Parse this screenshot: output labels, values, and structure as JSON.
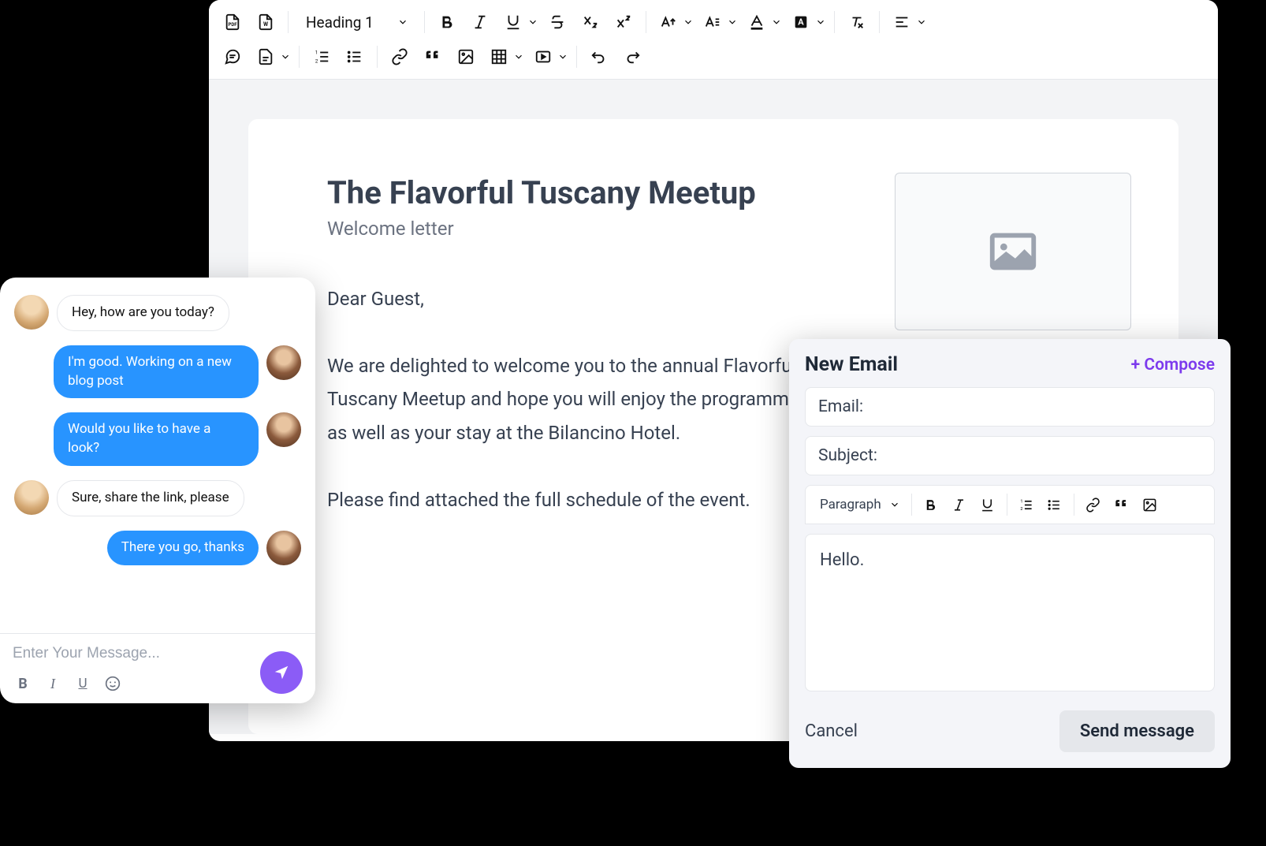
{
  "editor": {
    "toolbar": {
      "heading_dropdown": "Heading 1"
    },
    "document": {
      "title": "The Flavorful Tuscany Meetup",
      "subtitle": "Welcome letter",
      "greeting": "Dear Guest,",
      "paragraph1": "We are delighted to welcome you to the annual Flavorful Tuscany Meetup and hope you will enjoy the programme as well as your stay at the Bilancino Hotel.",
      "paragraph2": "Please find attached the full schedule of the event."
    }
  },
  "chat": {
    "messages": [
      {
        "side": "left",
        "avatar": "blonde",
        "text": "Hey, how are you today?"
      },
      {
        "side": "right",
        "avatar": "glasses",
        "text": "I'm good. Working on a new blog post"
      },
      {
        "side": "right",
        "avatar": "glasses",
        "text": "Would you like to have a look?"
      },
      {
        "side": "left",
        "avatar": "blonde",
        "text": "Sure, share the link, please"
      },
      {
        "side": "right",
        "avatar": "glasses",
        "text": "There you go, thanks"
      }
    ],
    "input_placeholder": "Enter Your Message..."
  },
  "email": {
    "title": "New Email",
    "compose_link": "+ Compose",
    "email_label": "Email:",
    "subject_label": "Subject:",
    "toolbar_dropdown": "Paragraph",
    "body": "Hello.",
    "cancel": "Cancel",
    "send": "Send message"
  }
}
